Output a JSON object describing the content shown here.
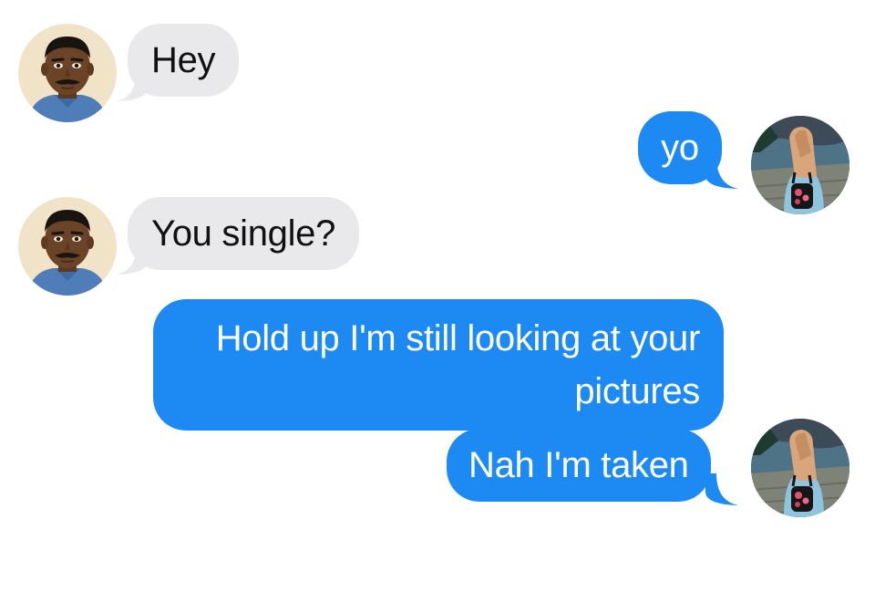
{
  "colors": {
    "sent_bubble": "#1d8af3",
    "received_bubble": "#e9e9eb",
    "sent_text": "#ffffff",
    "received_text": "#111111",
    "background": "#ffffff"
  },
  "participants": {
    "contact": {
      "avatar": "man-avatar"
    },
    "me": {
      "avatar": "woman-avatar"
    }
  },
  "messages": [
    {
      "from": "contact",
      "text": "Hey"
    },
    {
      "from": "me",
      "text": "yo"
    },
    {
      "from": "contact",
      "text": "You single?"
    },
    {
      "from": "me",
      "text": "Hold up I'm still looking at your pictures"
    },
    {
      "from": "me",
      "text": "Nah I'm taken"
    }
  ]
}
